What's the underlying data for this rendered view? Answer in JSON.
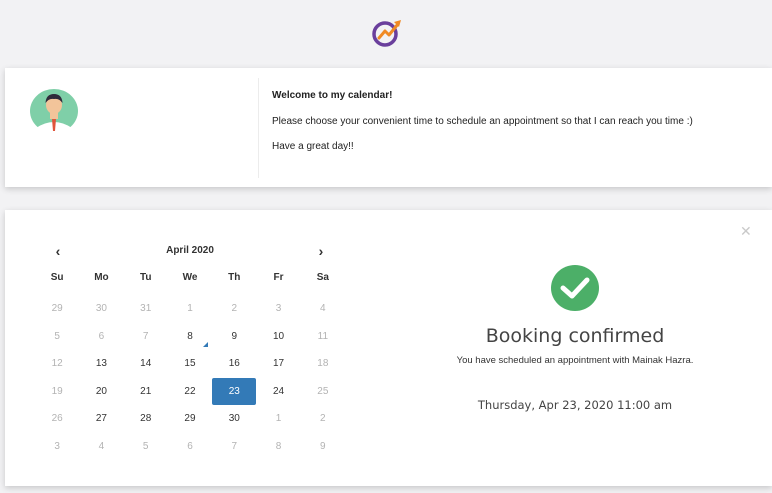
{
  "colors": {
    "accent": "#337ab7",
    "success": "#4caf68",
    "logo_purple": "#6a3f9c",
    "logo_orange": "#f08a24"
  },
  "icons": [
    "logo-icon",
    "avatar-icon",
    "close-icon",
    "chevron-left-icon",
    "chevron-right-icon",
    "check-circle-icon"
  ],
  "profile": {
    "welcome_title": "Welcome to my calendar!",
    "line1": "Please choose your convenient time to schedule an appointment so that I can reach you time :)",
    "line2": "Have a great day!!"
  },
  "calendar": {
    "month_label": "April 2020",
    "prev_label": "‹",
    "next_label": "›",
    "weekdays": [
      "Su",
      "Mo",
      "Tu",
      "We",
      "Th",
      "Fr",
      "Sa"
    ],
    "weeks": [
      [
        {
          "d": "29",
          "m": true
        },
        {
          "d": "30",
          "m": true
        },
        {
          "d": "31",
          "m": true
        },
        {
          "d": "1",
          "m": true
        },
        {
          "d": "2",
          "m": true
        },
        {
          "d": "3",
          "m": true
        },
        {
          "d": "4",
          "m": true
        }
      ],
      [
        {
          "d": "5",
          "m": true
        },
        {
          "d": "6",
          "m": true
        },
        {
          "d": "7",
          "m": true
        },
        {
          "d": "8",
          "m": false,
          "today": true
        },
        {
          "d": "9",
          "m": false
        },
        {
          "d": "10",
          "m": false
        },
        {
          "d": "11",
          "m": true
        }
      ],
      [
        {
          "d": "12",
          "m": true
        },
        {
          "d": "13",
          "m": false
        },
        {
          "d": "14",
          "m": false
        },
        {
          "d": "15",
          "m": false
        },
        {
          "d": "16",
          "m": false
        },
        {
          "d": "17",
          "m": false
        },
        {
          "d": "18",
          "m": true
        }
      ],
      [
        {
          "d": "19",
          "m": true
        },
        {
          "d": "20",
          "m": false
        },
        {
          "d": "21",
          "m": false
        },
        {
          "d": "22",
          "m": false
        },
        {
          "d": "23",
          "m": false,
          "selected": true
        },
        {
          "d": "24",
          "m": false
        },
        {
          "d": "25",
          "m": true
        }
      ],
      [
        {
          "d": "26",
          "m": true
        },
        {
          "d": "27",
          "m": false
        },
        {
          "d": "28",
          "m": false
        },
        {
          "d": "29",
          "m": false
        },
        {
          "d": "30",
          "m": false
        },
        {
          "d": "1",
          "m": true
        },
        {
          "d": "2",
          "m": true
        }
      ],
      [
        {
          "d": "3",
          "m": true
        },
        {
          "d": "4",
          "m": true
        },
        {
          "d": "5",
          "m": true
        },
        {
          "d": "6",
          "m": true
        },
        {
          "d": "7",
          "m": true
        },
        {
          "d": "8",
          "m": true
        },
        {
          "d": "9",
          "m": true
        }
      ]
    ]
  },
  "confirmation": {
    "title": "Booking confirmed",
    "subtitle": "You have scheduled an appointment with Mainak Hazra.",
    "datetime": "Thursday, Apr 23, 2020 11:00 am"
  }
}
